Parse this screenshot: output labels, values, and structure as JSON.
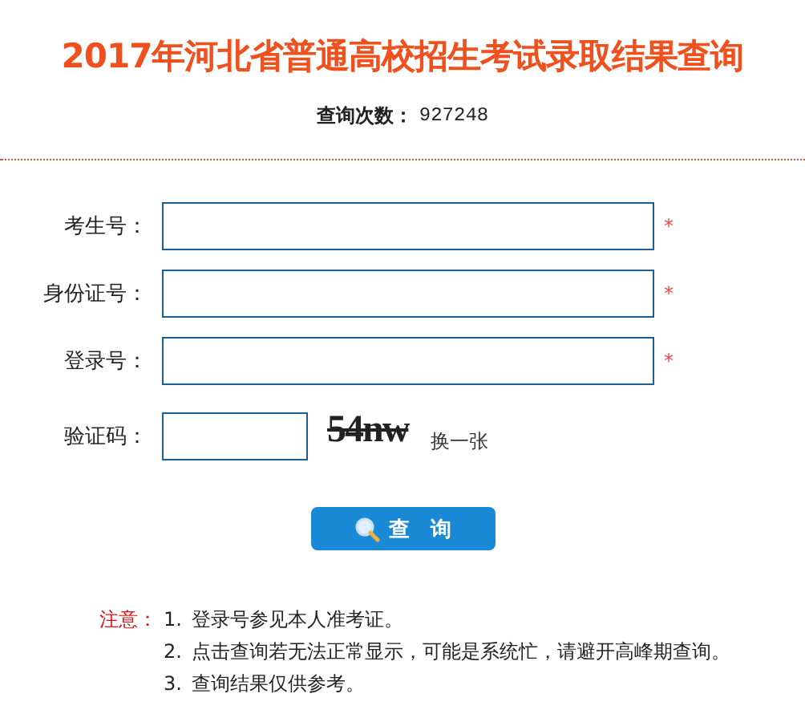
{
  "title": "2017年河北省普通高校招生考试录取结果查询",
  "counter": {
    "label": "查询次数：",
    "value": "927248"
  },
  "fields": [
    {
      "label": "考生号：",
      "required": true,
      "marker": "*"
    },
    {
      "label": "身份证号：",
      "required": true,
      "marker": "*"
    },
    {
      "label": "登录号：",
      "required": true,
      "marker": "*"
    }
  ],
  "captcha": {
    "label": "验证码：",
    "code": "54nw",
    "refresh": "换一张"
  },
  "submit": {
    "label": "查　询"
  },
  "notes": {
    "heading": "注意：",
    "items": [
      {
        "number": "1.",
        "text": "登录号参见本人准考证。"
      },
      {
        "number": "2.",
        "text": "点击查询若无法正常显示，可能是系统忙，请避开高峰期查询。"
      },
      {
        "number": "3.",
        "text": "查询结果仅供参考。"
      }
    ]
  }
}
